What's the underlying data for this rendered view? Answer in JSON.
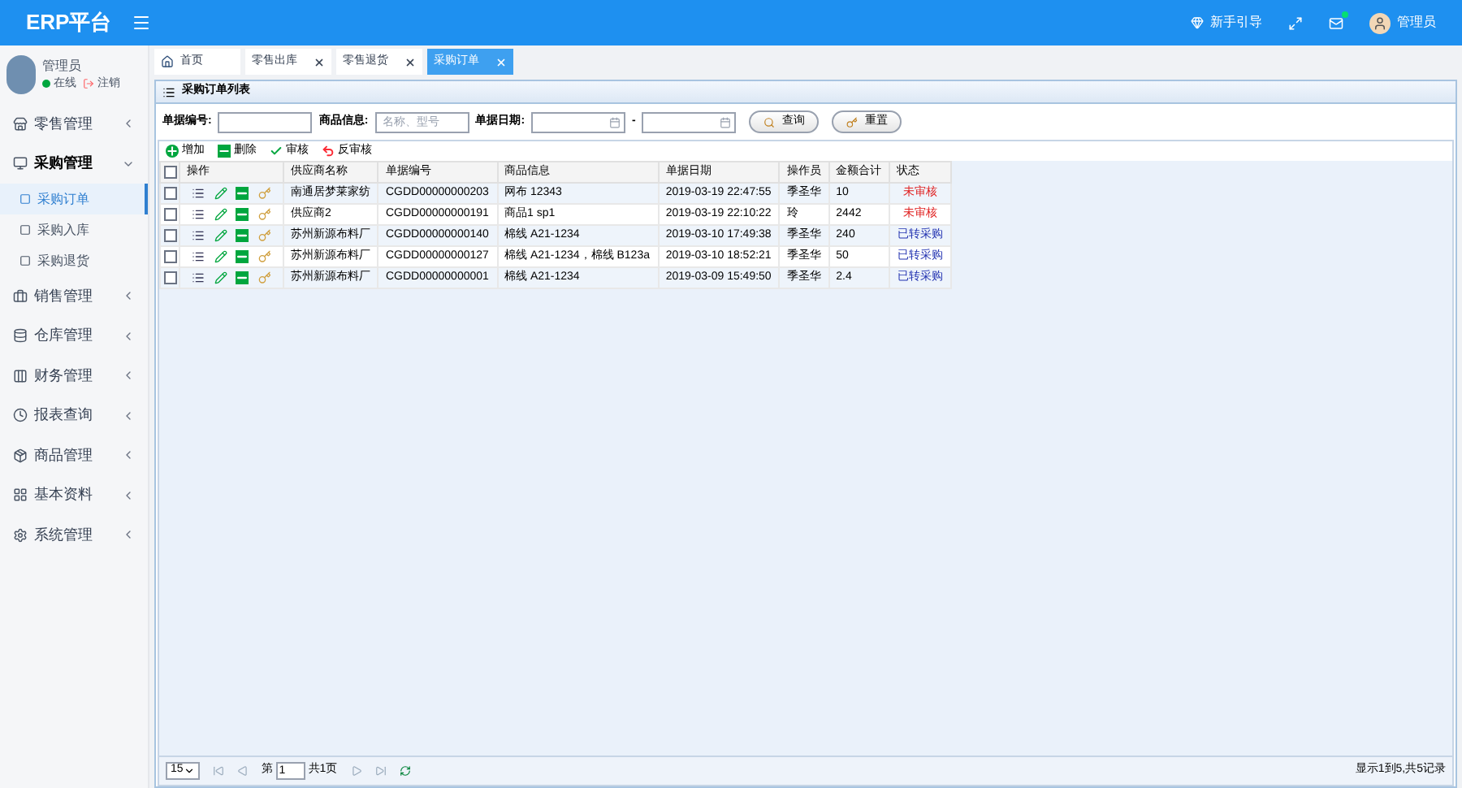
{
  "header": {
    "logo": "ERP平台",
    "links": [
      {
        "kind": "guide",
        "label": "新手引导"
      },
      {
        "kind": "fullscreen"
      },
      {
        "kind": "mail"
      },
      {
        "kind": "user",
        "label": "管理员"
      }
    ]
  },
  "user": {
    "name": "管理员",
    "status": "在线",
    "logout": "注销"
  },
  "sidebar": {
    "items": [
      {
        "label": "零售管理",
        "expanded": false
      },
      {
        "label": "采购管理",
        "expanded": true,
        "children": [
          {
            "label": "采购订单",
            "selected": true
          },
          {
            "label": "采购入库",
            "selected": false
          },
          {
            "label": "采购退货",
            "selected": false
          }
        ]
      },
      {
        "label": "销售管理",
        "expanded": false
      },
      {
        "label": "仓库管理",
        "expanded": false
      },
      {
        "label": "财务管理",
        "expanded": false
      },
      {
        "label": "报表查询",
        "expanded": false
      },
      {
        "label": "商品管理",
        "expanded": false
      },
      {
        "label": "基本资料",
        "expanded": false
      },
      {
        "label": "系统管理",
        "expanded": false
      }
    ]
  },
  "tabs": [
    {
      "label": "首页",
      "selected": false,
      "closable": false
    },
    {
      "label": "零售出库",
      "selected": false,
      "closable": true
    },
    {
      "label": "零售退货",
      "selected": false,
      "closable": true
    },
    {
      "label": "采购订单",
      "selected": true,
      "closable": true
    }
  ],
  "panel": {
    "title": "采购订单列表"
  },
  "search": {
    "fields": [
      {
        "label": "单据编号:"
      },
      {
        "label": "商品信息:",
        "placeholder": "名称、型号"
      }
    ],
    "date_label": "单据日期:",
    "date_sep": "-",
    "buttons": [
      {
        "kind": "search",
        "label": "查询"
      },
      {
        "kind": "reset",
        "label": "重置"
      }
    ]
  },
  "toolbar": [
    {
      "kind": "add",
      "label": "增加"
    },
    {
      "kind": "delete",
      "label": "删除"
    },
    {
      "kind": "approve",
      "label": "审核"
    },
    {
      "kind": "unapprove",
      "label": "反审核"
    }
  ],
  "table": {
    "header_checked": false,
    "columns": [
      "操作",
      "供应商名称",
      "单据编号",
      "商品信息",
      "单据日期",
      "操作员",
      "金额合计",
      "状态"
    ],
    "rows": [
      {
        "checked": false,
        "cells": [
          "",
          "南通居梦莱家纺",
          "CGDD00000000203",
          "网布 12343",
          "2019-03-19 22:47:55",
          "季圣华",
          "10",
          "未审核"
        ],
        "color": "#e02020"
      },
      {
        "checked": false,
        "cells": [
          "",
          "供应商2",
          "CGDD00000000191",
          "商品1 sp1",
          "2019-03-19 22:10:22",
          "玲",
          "2442",
          "未审核"
        ],
        "color": "#e02020"
      },
      {
        "checked": false,
        "cells": [
          "",
          "苏州新源布料厂",
          "CGDD00000000140",
          "棉线 A21-1234",
          "2019-03-10 17:49:38",
          "季圣华",
          "240",
          "已转采购"
        ],
        "color": "#2030b0"
      },
      {
        "checked": false,
        "cells": [
          "",
          "苏州新源布料厂",
          "CGDD00000000127",
          "棉线 A21-1234，棉线 B123a",
          "2019-03-10 18:52:21",
          "季圣华",
          "50",
          "已转采购"
        ],
        "color": "#2030b0"
      },
      {
        "checked": false,
        "cells": [
          "",
          "苏州新源布料厂",
          "CGDD00000000001",
          "棉线 A21-1234",
          "2019-03-09 15:49:50",
          "季圣华",
          "2.4",
          "已转采购"
        ],
        "color": "#2030b0"
      }
    ]
  },
  "pager": {
    "page_size": "15",
    "page_prefix": "第",
    "page": "1",
    "page_total": "共1页",
    "summary": "显示1到5,共5记录"
  }
}
